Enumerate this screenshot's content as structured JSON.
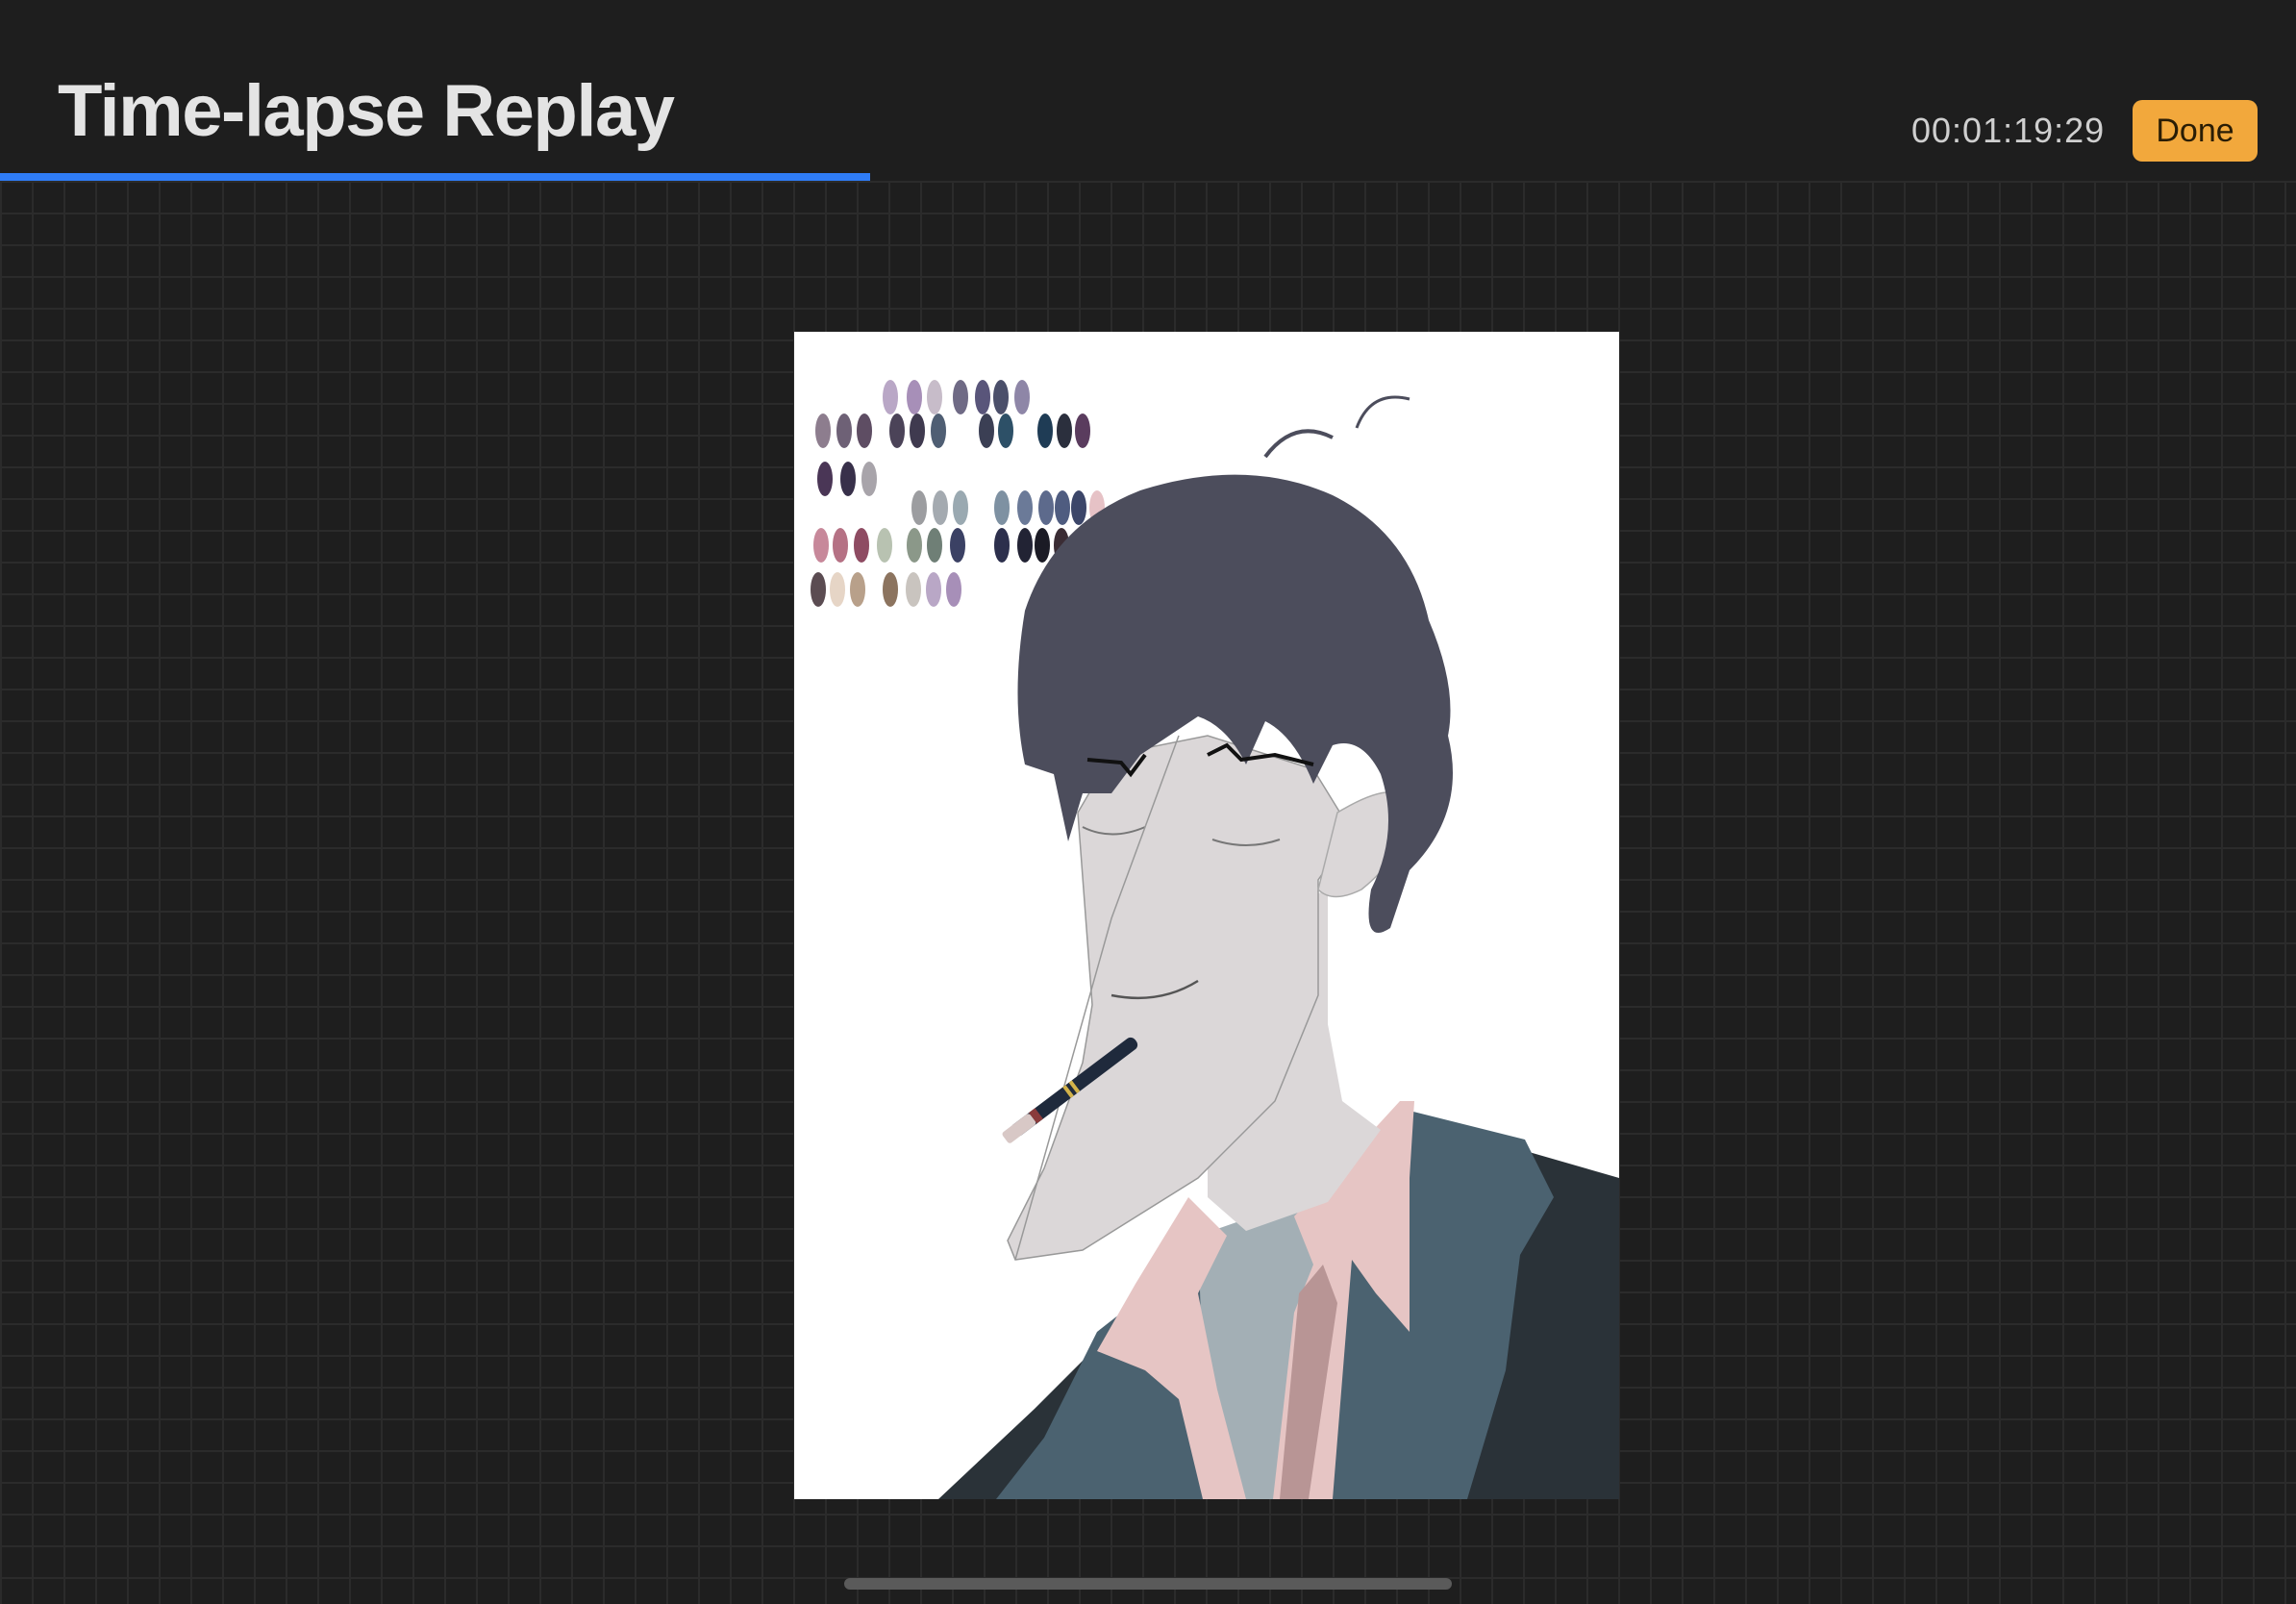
{
  "header": {
    "title": "Time-lapse Replay",
    "timestamp": "00:01:19:29",
    "done_label": "Done"
  },
  "playback": {
    "progress": 0.379
  },
  "canvas": {
    "subject": "artwork-portrait",
    "palette_swatches": [
      "#b9a7c6",
      "#a78fb8",
      "#c7bcc9",
      "#6f6a85",
      "#59557a",
      "#4b4f6a",
      "#8e86a7",
      "#8d7d8e",
      "#6e6176",
      "#5e4d63",
      "#4b4358",
      "#3f3a4f",
      "#4f5e73",
      "#3b3f54",
      "#2d5067",
      "#1f3c55",
      "#2b2f3d",
      "#5a3c5e",
      "#4a3656",
      "#38304a",
      "#a8a4aa",
      "#9c9da0",
      "#a4aab0",
      "#9aa9b1",
      "#7e91a2",
      "#6b7a98",
      "#5d6a8c",
      "#4f5c80",
      "#3c4669",
      "#e6c2c6",
      "#c7889a",
      "#b57184",
      "#8e4b62",
      "#b8c2b1",
      "#8b9889",
      "#6f7f76",
      "#3b4164",
      "#2c2f4c",
      "#222334",
      "#1b1b25",
      "#3a2c34",
      "#2a2230",
      "#5b4c52",
      "#e6d5c6",
      "#b8a08a",
      "#8c745f",
      "#c9c4bf"
    ],
    "colors": {
      "hair": "#4c4d5c",
      "skin": "#dbd7d8",
      "shirt": "#e6c5c4",
      "jacket": "#4b6270",
      "jacket_dark": "#2a3238",
      "tshirt": "#a3afb5"
    }
  }
}
